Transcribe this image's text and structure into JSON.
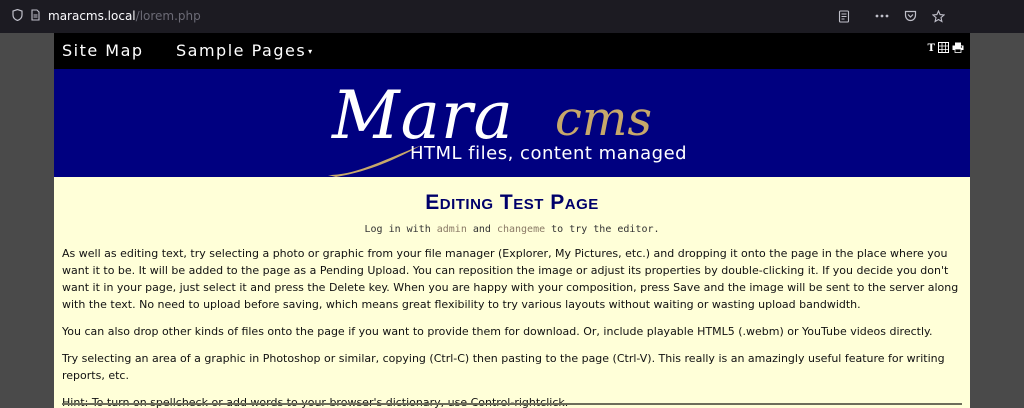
{
  "browser": {
    "url_host": "maracms.local",
    "url_path": "/lorem.php",
    "icons": [
      "shield-icon",
      "page-icon",
      "reader-view-icon",
      "more-icon",
      "pocket-icon",
      "bookmark-star-icon"
    ]
  },
  "nav": {
    "site_map": "Site Map",
    "sample_pages": "Sample Pages",
    "tools": [
      "T",
      "grid-icon",
      "print-icon"
    ]
  },
  "banner": {
    "logo_main": "Mara",
    "logo_accent": "cms",
    "tagline": "HTML files, content managed"
  },
  "main": {
    "title": "Editing Test Page",
    "login_prefix": "Log in with ",
    "login_user": "admin",
    "login_and": " and ",
    "login_pass": "changeme",
    "login_suffix": " to try the editor.",
    "paragraphs": [
      "As well as editing text, try selecting a photo or graphic from your file manager (Explorer, My Pictures, etc.) and dropping it onto the page in the place where you want it to be.  It will be added to the page as a Pending Upload. You can reposition the image or adjust its properties by double-clicking it. If you decide you don't want it in your page, just select it and press the Delete key.  When you are happy with your composition, press Save and the image will be sent to the server along with the text. No need to upload before saving, which means great flexibility to try various layouts without waiting or wasting upload bandwidth.",
      "You can also drop other kinds of files onto the page if you want to provide them for download. Or, include playable HTML5 (.webm) or YouTube videos directly.",
      "Try selecting an area of a graphic in Photoshop or similar, copying (Ctrl-C) then pasting to the page (Ctrl-V). This really is an amazingly useful feature for writing reports, etc.",
      "Hint: To turn on spellcheck or add words to your browser's dictionary, use Control-rightclick."
    ]
  }
}
